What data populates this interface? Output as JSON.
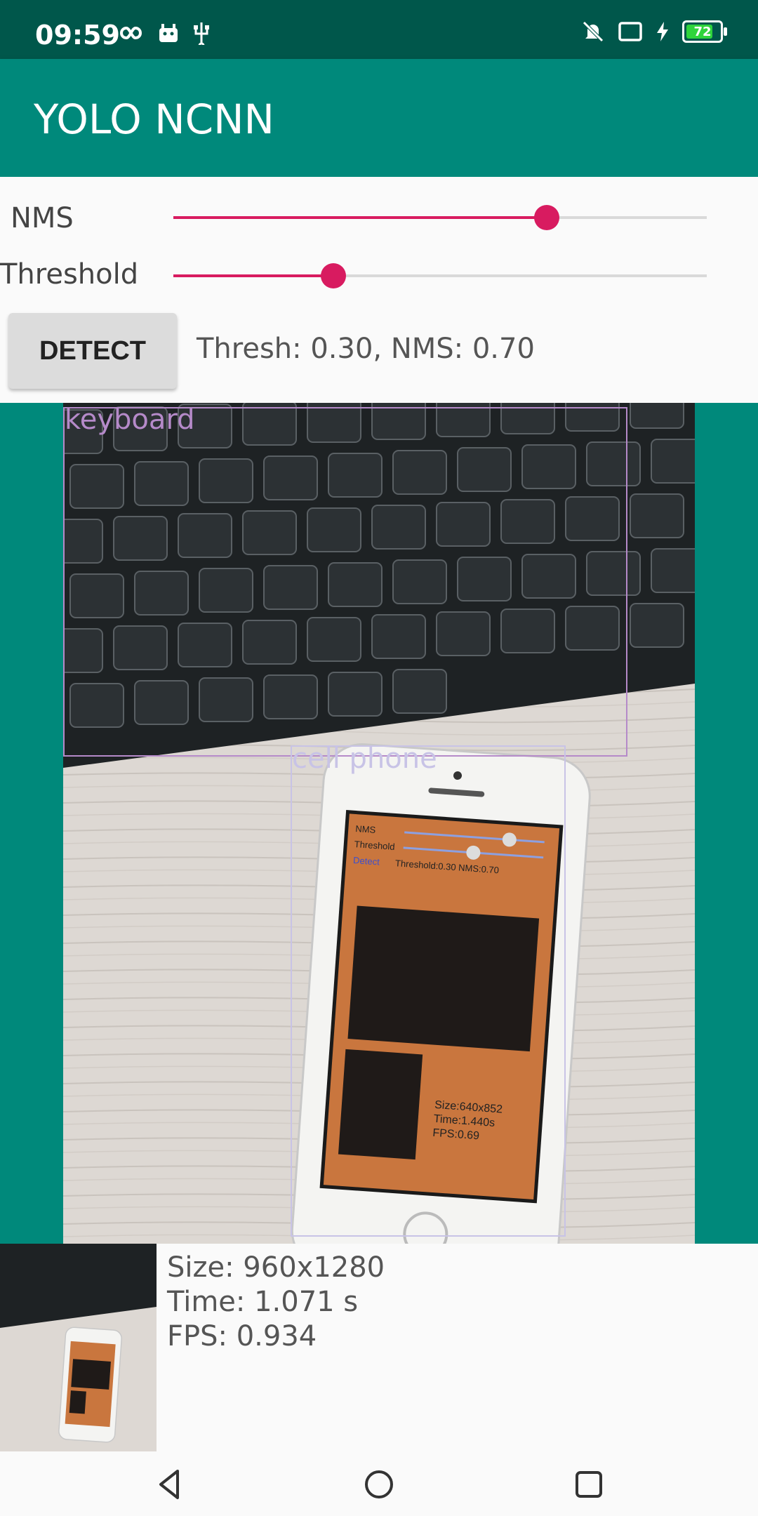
{
  "status_bar": {
    "time": "09:59",
    "battery_level": "72",
    "icons": [
      "infinity-icon",
      "android-icon",
      "usb-icon",
      "mute-icon",
      "cast-icon",
      "charging-icon",
      "battery-icon"
    ]
  },
  "app_bar": {
    "title": "YOLO NCNN"
  },
  "controls": {
    "nms_label": "NMS",
    "nms_value": 0.7,
    "threshold_label": "Threshold",
    "threshold_value": 0.3,
    "detect_label": "DETECT",
    "params_text": "Thresh: 0.30, NMS: 0.70"
  },
  "detections": [
    {
      "label": "keyboard",
      "color": "#b58ac9"
    },
    {
      "label": "cell phone",
      "color": "#c8c3e6"
    }
  ],
  "phone_screen": {
    "nms_label": "NMS",
    "threshold_label": "Threshold",
    "detect_label": "Detect",
    "params_text": "Threshold:0.30 NMS:0.70",
    "stats": [
      "Size:640x852",
      "Time:1.440s",
      "FPS:0.69"
    ]
  },
  "stats": {
    "size": "Size: 960x1280",
    "time": "Time: 1.071 s",
    "fps": "FPS: 0.934"
  },
  "colors": {
    "accent": "#d81b60",
    "primary": "#00897b",
    "primary_dark": "#00574b"
  }
}
